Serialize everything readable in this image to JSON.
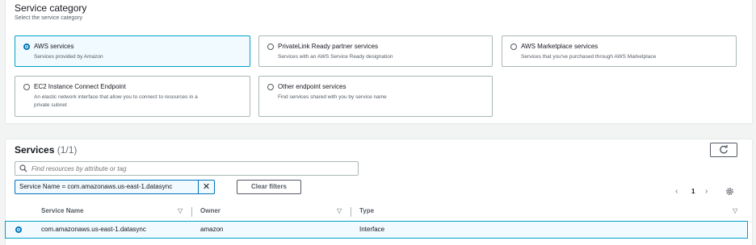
{
  "category": {
    "title": "Service category",
    "subtitle": "Select the service category",
    "options": [
      {
        "label": "AWS services",
        "desc": "Services provided by Amazon",
        "selected": true
      },
      {
        "label": "PrivateLink Ready partner services",
        "desc": "Services with an AWS Service Ready designation",
        "selected": false
      },
      {
        "label": "AWS Marketplace services",
        "desc": "Services that you've purchased through AWS Marketplace",
        "selected": false
      },
      {
        "label": "EC2 Instance Connect Endpoint",
        "desc_line1": "An elastic network interface that allow you to connect to resources in a",
        "desc_line2": "private subnet",
        "selected": false
      },
      {
        "label": "Other endpoint services",
        "desc": "Find services shared with you by service name",
        "selected": false
      }
    ]
  },
  "services": {
    "title": "Services",
    "count": "(1/1)",
    "refresh_icon": "refresh-icon",
    "search": {
      "placeholder": "Find resources by attribute or tag",
      "icon": "search-icon"
    },
    "filter_token": "Service Name = com.amazonaws.us-east-1.datasync",
    "clear_filters": "Clear filters",
    "pagination": {
      "prev": "‹",
      "page": "1",
      "next": "›"
    },
    "settings_icon": "gear-icon",
    "columns": [
      "Service Name",
      "Owner",
      "Type"
    ],
    "rows": [
      {
        "service_name": "com.amazonaws.us-east-1.datasync",
        "owner": "amazon",
        "type": "Interface",
        "selected": true
      }
    ]
  },
  "colors": {
    "accent": "#0073bb",
    "selected_border": "#00a1c9",
    "selected_bg": "#f1faff"
  }
}
